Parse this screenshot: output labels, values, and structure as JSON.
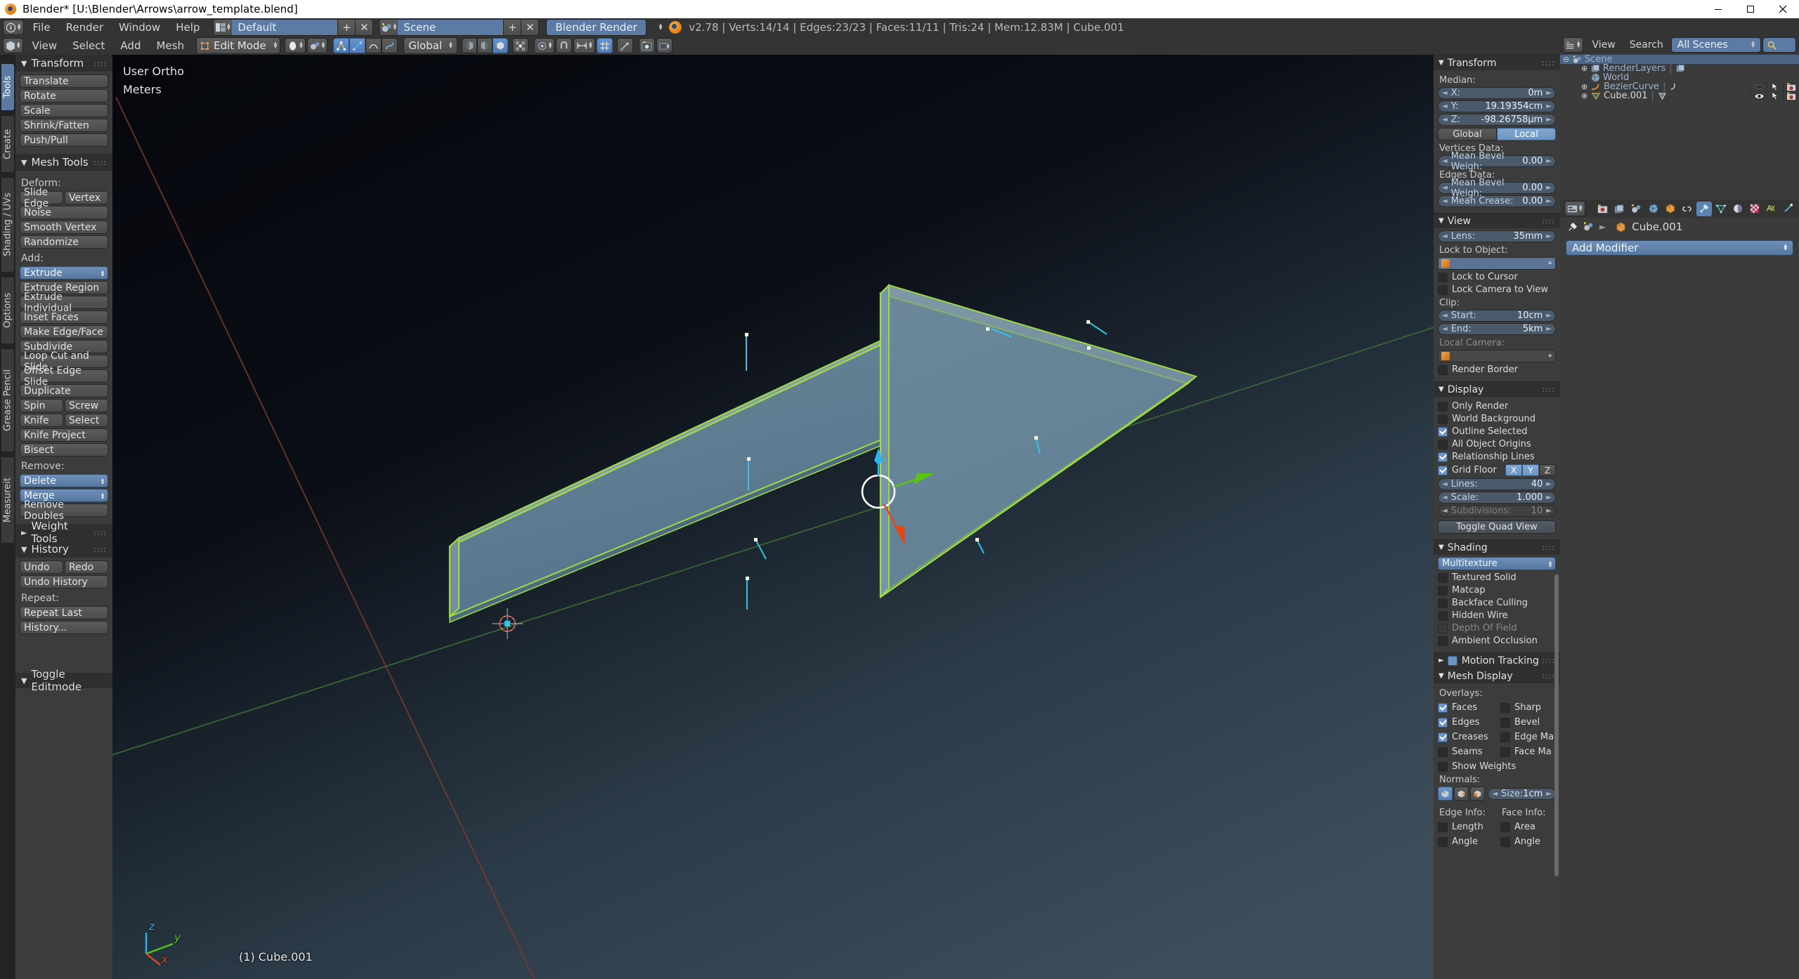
{
  "window": {
    "title": "Blender* [U:\\Blender\\Arrows\\arrow_template.blend]",
    "minimize": "—",
    "maximize": "▢",
    "close": "✕"
  },
  "topbar": {
    "menus": [
      "File",
      "Render",
      "Window",
      "Help"
    ],
    "screen_layout": "Default",
    "scene_name": "Scene",
    "engine": "Blender Render",
    "add_label": "+",
    "remove_label": "✕",
    "stats": "v2.78 | Verts:14/14 | Edges:23/23 | Faces:11/11 | Tris:24 | Mem:12.83M | Cube.001"
  },
  "viewheader": {
    "menus": [
      "View",
      "Select",
      "Add",
      "Mesh"
    ],
    "mode": "Edit Mode",
    "transform_orientation": "Global"
  },
  "toolshelf": {
    "tabs": [
      "Tools",
      "Create",
      "Shading / UVs",
      "Options",
      "Grease Pencil",
      "Measureit"
    ],
    "active_tab": "Tools",
    "panels": [
      {
        "title": "Transform",
        "open": true,
        "groups": [
          {
            "type": "single",
            "items": [
              "Translate"
            ]
          },
          {
            "type": "single",
            "items": [
              "Rotate"
            ]
          },
          {
            "type": "single",
            "items": [
              "Scale"
            ]
          },
          {
            "type": "single",
            "items": [
              "Shrink/Fatten"
            ]
          },
          {
            "type": "single",
            "items": [
              "Push/Pull"
            ]
          }
        ]
      },
      {
        "title": "Mesh Tools",
        "open": true,
        "sections": [
          {
            "label": "Deform:",
            "rows": [
              {
                "type": "pair",
                "items": [
                  "Slide Edge",
                  "Vertex"
                ]
              },
              {
                "type": "single",
                "items": [
                  "Noise"
                ]
              },
              {
                "type": "single",
                "items": [
                  "Smooth Vertex"
                ]
              },
              {
                "type": "single",
                "items": [
                  "Randomize"
                ]
              }
            ]
          },
          {
            "label": "Add:",
            "rows": [
              {
                "type": "menu",
                "items": [
                  "Extrude"
                ]
              },
              {
                "type": "single",
                "items": [
                  "Extrude Region"
                ]
              },
              {
                "type": "single",
                "items": [
                  "Extrude Individual"
                ]
              },
              {
                "type": "single",
                "items": [
                  "Inset Faces"
                ]
              },
              {
                "type": "single",
                "items": [
                  "Make Edge/Face"
                ]
              },
              {
                "type": "single",
                "items": [
                  "Subdivide"
                ]
              },
              {
                "type": "single",
                "items": [
                  "Loop Cut and Slide"
                ]
              },
              {
                "type": "single",
                "items": [
                  "Offset Edge Slide"
                ]
              },
              {
                "type": "single",
                "items": [
                  "Duplicate"
                ]
              },
              {
                "type": "pair",
                "items": [
                  "Spin",
                  "Screw"
                ]
              },
              {
                "type": "pair",
                "items": [
                  "Knife",
                  "Select"
                ]
              },
              {
                "type": "single",
                "items": [
                  "Knife Project"
                ]
              },
              {
                "type": "single",
                "items": [
                  "Bisect"
                ]
              }
            ]
          },
          {
            "label": "Remove:",
            "rows": [
              {
                "type": "menu",
                "items": [
                  "Delete"
                ]
              },
              {
                "type": "menu",
                "items": [
                  "Merge"
                ]
              },
              {
                "type": "single",
                "items": [
                  "Remove Doubles"
                ]
              }
            ]
          }
        ]
      },
      {
        "title": "Weight Tools",
        "open": false
      },
      {
        "title": "History",
        "open": true,
        "sections": [
          {
            "label": "",
            "rows": [
              {
                "type": "pair",
                "items": [
                  "Undo",
                  "Redo"
                ]
              },
              {
                "type": "single",
                "items": [
                  "Undo History"
                ]
              }
            ]
          },
          {
            "label": "Repeat:",
            "rows": [
              {
                "type": "single",
                "items": [
                  "Repeat Last"
                ]
              },
              {
                "type": "single",
                "items": [
                  "History..."
                ]
              }
            ]
          }
        ]
      }
    ],
    "toggle_editmode": "Toggle Editmode"
  },
  "viewport": {
    "view_name": "User Ortho",
    "unit_name": "Meters",
    "object_info": "(1) Cube.001",
    "axes": {
      "x": "x",
      "y": "y",
      "z": "z"
    },
    "colors": {
      "axis_x": "#e04a1a",
      "axis_y": "#58c413",
      "axis_z": "#29b6e8",
      "mesh_face": "#5f7f96",
      "mesh_edge": "#9ede3f",
      "background_dark": "#06080e",
      "background_light": "#3b4b58"
    }
  },
  "npanel": {
    "transform": {
      "title": "Transform",
      "median_label": "Median:",
      "fields": [
        {
          "label": "X:",
          "value": "0m"
        },
        {
          "label": "Y:",
          "value": "19.19354cm"
        },
        {
          "label": "Z:",
          "value": "-98.26758µm"
        }
      ],
      "space": {
        "options": [
          "Global",
          "Local"
        ],
        "selected": "Local"
      },
      "vertices_data_label": "Vertices Data:",
      "vertices_fields": [
        {
          "label": "Mean Bevel Weigh:",
          "value": "0.00"
        }
      ],
      "edges_data_label": "Edges Data:",
      "edges_fields": [
        {
          "label": "Mean Bevel Weigh:",
          "value": "0.00"
        },
        {
          "label": "Mean Crease:",
          "value": "0.00"
        }
      ]
    },
    "view": {
      "title": "View",
      "lens": {
        "label": "Lens:",
        "value": "35mm"
      },
      "lock_to_object_label": "Lock to Object:",
      "lock_to_object_value": "",
      "lock_to_cursor": {
        "label": "Lock to Cursor",
        "checked": false
      },
      "lock_camera_to_view": {
        "label": "Lock Camera to View",
        "checked": false
      },
      "clip_label": "Clip:",
      "clip_start": {
        "label": "Start:",
        "value": "10cm"
      },
      "clip_end": {
        "label": "End:",
        "value": "5km"
      },
      "local_camera_label": "Local Camera:",
      "local_camera_value": "",
      "render_border": {
        "label": "Render Border",
        "checked": false
      }
    },
    "display": {
      "title": "Display",
      "checks": [
        {
          "label": "Only Render",
          "checked": false
        },
        {
          "label": "World Background",
          "checked": false
        },
        {
          "label": "Outline Selected",
          "checked": true
        },
        {
          "label": "All Object Origins",
          "checked": false
        },
        {
          "label": "Relationship Lines",
          "checked": true
        }
      ],
      "grid_floor": {
        "label": "Grid Floor",
        "checked": true,
        "axes": [
          {
            "label": "X",
            "on": true
          },
          {
            "label": "Y",
            "on": true
          },
          {
            "label": "Z",
            "on": false
          }
        ]
      },
      "lines": {
        "label": "Lines:",
        "value": "40"
      },
      "scale": {
        "label": "Scale:",
        "value": "1.000"
      },
      "subdivisions": {
        "label": "Subdivisions:",
        "value": "10",
        "disabled": true
      },
      "toggle_quad_view": "Toggle Quad View"
    },
    "shading": {
      "title": "Shading",
      "method": "Multitexture",
      "checks": [
        {
          "label": "Textured Solid",
          "checked": false,
          "disabled": false
        },
        {
          "label": "Matcap",
          "checked": false,
          "disabled": false
        },
        {
          "label": "Backface Culling",
          "checked": false,
          "disabled": false
        },
        {
          "label": "Hidden Wire",
          "checked": false,
          "disabled": false
        },
        {
          "label": "Depth Of Field",
          "checked": false,
          "disabled": true
        },
        {
          "label": "Ambient Occlusion",
          "checked": false,
          "disabled": false
        }
      ]
    },
    "motion_tracking": {
      "title": "Motion Tracking",
      "checked": true,
      "open": false
    },
    "mesh_display": {
      "title": "Mesh Display",
      "overlays_label": "Overlays:",
      "overlays": [
        {
          "left": {
            "label": "Faces",
            "checked": true
          },
          "right": {
            "label": "Sharp",
            "checked": false
          }
        },
        {
          "left": {
            "label": "Edges",
            "checked": true
          },
          "right": {
            "label": "Bevel",
            "checked": false
          }
        },
        {
          "left": {
            "label": "Creases",
            "checked": true
          },
          "right": {
            "label": "Edge Ma",
            "checked": false
          }
        },
        {
          "left": {
            "label": "Seams",
            "checked": false
          },
          "right": {
            "label": "Face Ma",
            "checked": false
          }
        }
      ],
      "show_weights": {
        "label": "Show Weights",
        "checked": false
      },
      "normals_label": "Normals:",
      "normals_buttons": [
        {
          "name": "vertex-normals",
          "on": true
        },
        {
          "name": "split-normals",
          "on": false
        },
        {
          "name": "face-normals",
          "on": false
        }
      ],
      "normals_size": {
        "label": "Size:",
        "value": "1cm"
      },
      "edge_info_label": "Edge Info:",
      "face_info_label": "Face Info:",
      "edge_info": [
        {
          "label": "Length",
          "checked": false
        },
        {
          "label": "Angle",
          "checked": false
        }
      ],
      "face_info": [
        {
          "label": "Area",
          "checked": false
        },
        {
          "label": "Angle",
          "checked": false
        }
      ]
    }
  },
  "outliner": {
    "menus": [
      "View",
      "Search"
    ],
    "display_mode": "All Scenes",
    "search_placeholder": "",
    "rows": [
      {
        "name": "Scene",
        "indent": 0,
        "expander": "−",
        "selected": true,
        "type": "scene"
      },
      {
        "name": "RenderLayers",
        "indent": 1,
        "expander": "+",
        "selected": false,
        "type": "renderlayers"
      },
      {
        "name": "World",
        "indent": 2,
        "expander": "",
        "selected": false,
        "type": "world"
      },
      {
        "name": "BezierCurve",
        "indent": 1,
        "expander": "+",
        "selected": false,
        "type": "curve"
      },
      {
        "name": "Cube.001",
        "indent": 1,
        "expander": "+",
        "selected": false,
        "type": "mesh"
      }
    ]
  },
  "properties": {
    "tabs": [
      "render",
      "render-layers",
      "scene",
      "world",
      "object",
      "constraints",
      "modifiers",
      "data",
      "material",
      "texture",
      "physics",
      "particles"
    ],
    "active_tab": "modifiers",
    "breadcrumb_object": "Cube.001",
    "add_modifier": "Add Modifier"
  }
}
